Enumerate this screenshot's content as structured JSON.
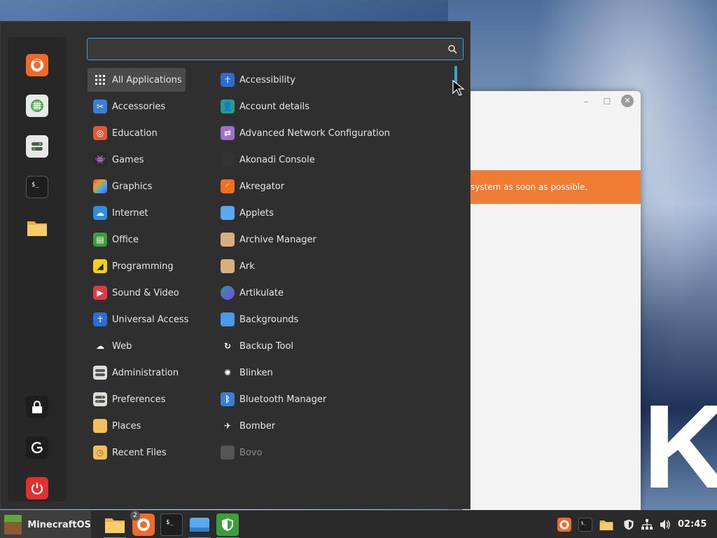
{
  "wallpaper": {
    "letter": "K"
  },
  "background_window": {
    "banner_text": "system as soon as possible.",
    "minimize_glyph": "–",
    "maximize_glyph": "☐",
    "close_glyph": "✕"
  },
  "menu": {
    "search": {
      "value": "",
      "placeholder": ""
    },
    "favorites": [
      {
        "icon": "firefox-icon"
      },
      {
        "icon": "software-manager-icon"
      },
      {
        "icon": "settings-icon"
      },
      {
        "icon": "terminal-icon"
      },
      {
        "icon": "folder-icon"
      },
      {
        "icon": "lock-icon"
      },
      {
        "icon": "logout-icon"
      },
      {
        "icon": "power-icon"
      }
    ],
    "categories": [
      {
        "label": "All Applications",
        "icon": "grid-icon",
        "color": "#3a3a3a"
      },
      {
        "label": "Accessories",
        "icon": "scissors-icon",
        "color": "#3a7fd5"
      },
      {
        "label": "Education",
        "icon": "education-icon",
        "color": "#e05a3a"
      },
      {
        "label": "Games",
        "icon": "gamepad-icon",
        "color": "#2b2b2b"
      },
      {
        "label": "Graphics",
        "icon": "palette-icon",
        "color": "#b04ad6"
      },
      {
        "label": "Internet",
        "icon": "cloud-icon",
        "color": "#2f8ee0"
      },
      {
        "label": "Office",
        "icon": "office-icon",
        "color": "#3d9c3d"
      },
      {
        "label": "Programming",
        "icon": "code-icon",
        "color": "#f0d020"
      },
      {
        "label": "Sound & Video",
        "icon": "play-icon",
        "color": "#e03a4a"
      },
      {
        "label": "Universal Access",
        "icon": "accessibility-icon",
        "color": "#2a6fd0"
      },
      {
        "label": "Web",
        "icon": "web-cloud-icon",
        "color": "#2f2f2f"
      },
      {
        "label": "Administration",
        "icon": "admin-icon",
        "color": "#dddddd"
      },
      {
        "label": "Preferences",
        "icon": "preferences-icon",
        "color": "#dddddd"
      },
      {
        "label": "Places",
        "icon": "places-folder-icon",
        "color": "#f0c060"
      },
      {
        "label": "Recent Files",
        "icon": "recent-folder-icon",
        "color": "#f0c060"
      }
    ],
    "apps": [
      {
        "label": "Accessibility",
        "icon": "accessibility-icon",
        "color": "#2a6fd0"
      },
      {
        "label": "Account details",
        "icon": "user-icon",
        "color": "#2a9a8a"
      },
      {
        "label": "Advanced Network Configuration",
        "icon": "network-icon",
        "color": "#a070d0"
      },
      {
        "label": "Akonadi Console",
        "icon": "akonadi-icon",
        "color": "#333333"
      },
      {
        "label": "Akregator",
        "icon": "rss-icon",
        "color": "#f07020"
      },
      {
        "label": "Applets",
        "icon": "applets-icon",
        "color": "#5aa8f0"
      },
      {
        "label": "Archive Manager",
        "icon": "archive-icon",
        "color": "#d8b080"
      },
      {
        "label": "Ark",
        "icon": "ark-icon",
        "color": "#d8b080"
      },
      {
        "label": "Artikulate",
        "icon": "artikulate-icon",
        "color": "#20a0a0"
      },
      {
        "label": "Backgrounds",
        "icon": "backgrounds-icon",
        "color": "#4a9ae8"
      },
      {
        "label": "Backup Tool",
        "icon": "backup-icon",
        "color": "#2f2f2f"
      },
      {
        "label": "Blinken",
        "icon": "blinken-icon",
        "color": "#2f2f2f"
      },
      {
        "label": "Bluetooth Manager",
        "icon": "bluetooth-icon",
        "color": "#3a7fd5"
      },
      {
        "label": "Bomber",
        "icon": "bomber-icon",
        "color": "#2f2f2f"
      },
      {
        "label": "Bovo",
        "icon": "bovo-icon",
        "color": "#555555"
      }
    ]
  },
  "taskbar": {
    "start_label": "MinecraftOS",
    "badge_count": "2",
    "clock": "02:45",
    "pinned": [
      {
        "icon": "folder-icon"
      },
      {
        "icon": "firefox-icon"
      },
      {
        "icon": "terminal-icon"
      },
      {
        "icon": "applets-icon"
      },
      {
        "icon": "shield-icon"
      }
    ],
    "tray": [
      {
        "icon": "firefox-icon"
      },
      {
        "icon": "terminal-icon"
      },
      {
        "icon": "folder-icon"
      },
      {
        "icon": "shield-icon"
      },
      {
        "icon": "network-icon"
      },
      {
        "icon": "volume-icon"
      }
    ]
  }
}
